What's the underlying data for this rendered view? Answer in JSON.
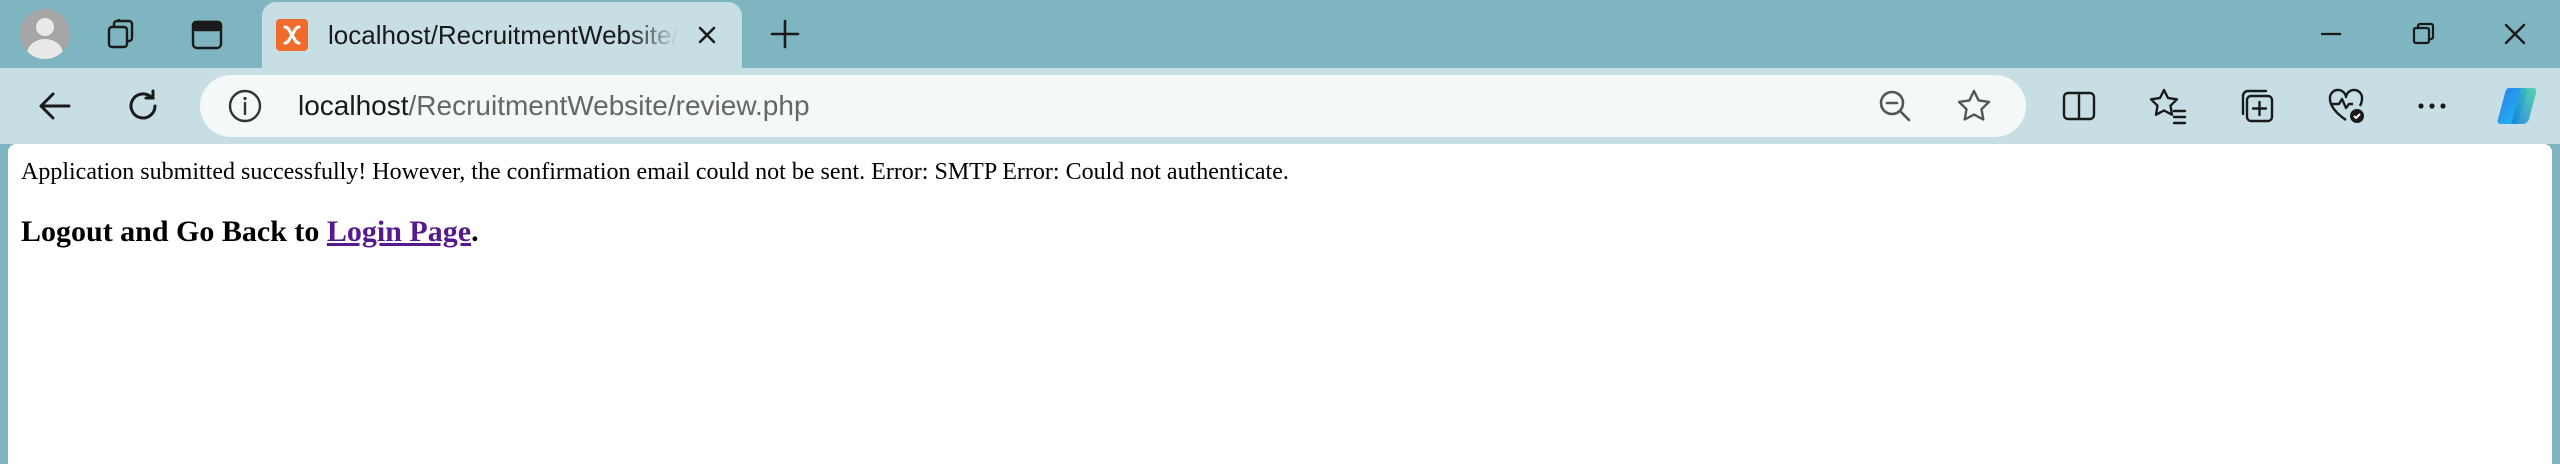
{
  "browser": {
    "tab": {
      "title": "localhost/RecruitmentWebsite/review.php",
      "favicon": "xampp-icon",
      "favicon_color": "#ef6c2c"
    },
    "address_bar": {
      "host": "localhost",
      "path": "/RecruitmentWebsite/review.php"
    },
    "colors": {
      "frame": "#7fb5c0",
      "toolbar": "#c7dfe4",
      "omnibox": "#f3f8f9"
    }
  },
  "page": {
    "message": "Application submitted successfully! However, the confirmation email could not be sent. Error: SMTP Error: Could not authenticate.",
    "logout_prefix": "Logout and Go Back to ",
    "login_link": "Login Page",
    "logout_suffix": ".",
    "link_color": "#551a8b"
  }
}
